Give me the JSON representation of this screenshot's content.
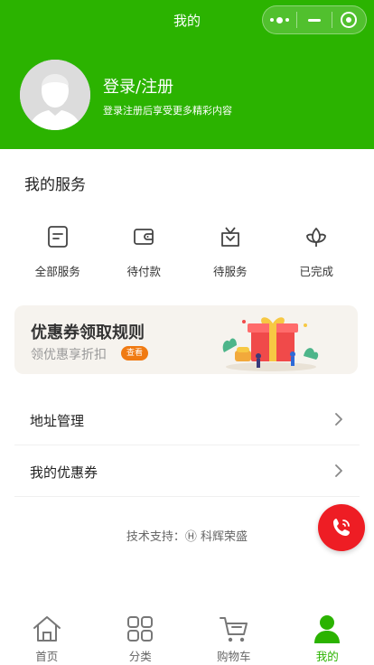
{
  "colors": {
    "brand": "#2bb300",
    "fab": "#ee1d24",
    "badge": "#f07a12"
  },
  "nav": {
    "title": "我的"
  },
  "profile": {
    "title": "登录/注册",
    "subtitle": "登录注册后享受更多精彩内容"
  },
  "services": {
    "title": "我的服务",
    "items": [
      {
        "label": "全部服务",
        "icon": "document-icon"
      },
      {
        "label": "待付款",
        "icon": "wallet-icon"
      },
      {
        "label": "待服务",
        "icon": "gift-box-icon"
      },
      {
        "label": "已完成",
        "icon": "lotus-icon"
      }
    ]
  },
  "banner": {
    "title": "优惠券领取规则",
    "subtitle": "领优惠享折扣",
    "button": "查看"
  },
  "list": [
    {
      "label": "地址管理"
    },
    {
      "label": "我的优惠券"
    }
  ],
  "support": {
    "text": "技术支持：Ⓗ 科辉荣盛"
  },
  "tabs": [
    {
      "label": "首页",
      "icon": "home-icon",
      "active": false
    },
    {
      "label": "分类",
      "icon": "category-icon",
      "active": false
    },
    {
      "label": "购物车",
      "icon": "cart-icon",
      "active": false
    },
    {
      "label": "我的",
      "icon": "user-icon",
      "active": true
    }
  ]
}
